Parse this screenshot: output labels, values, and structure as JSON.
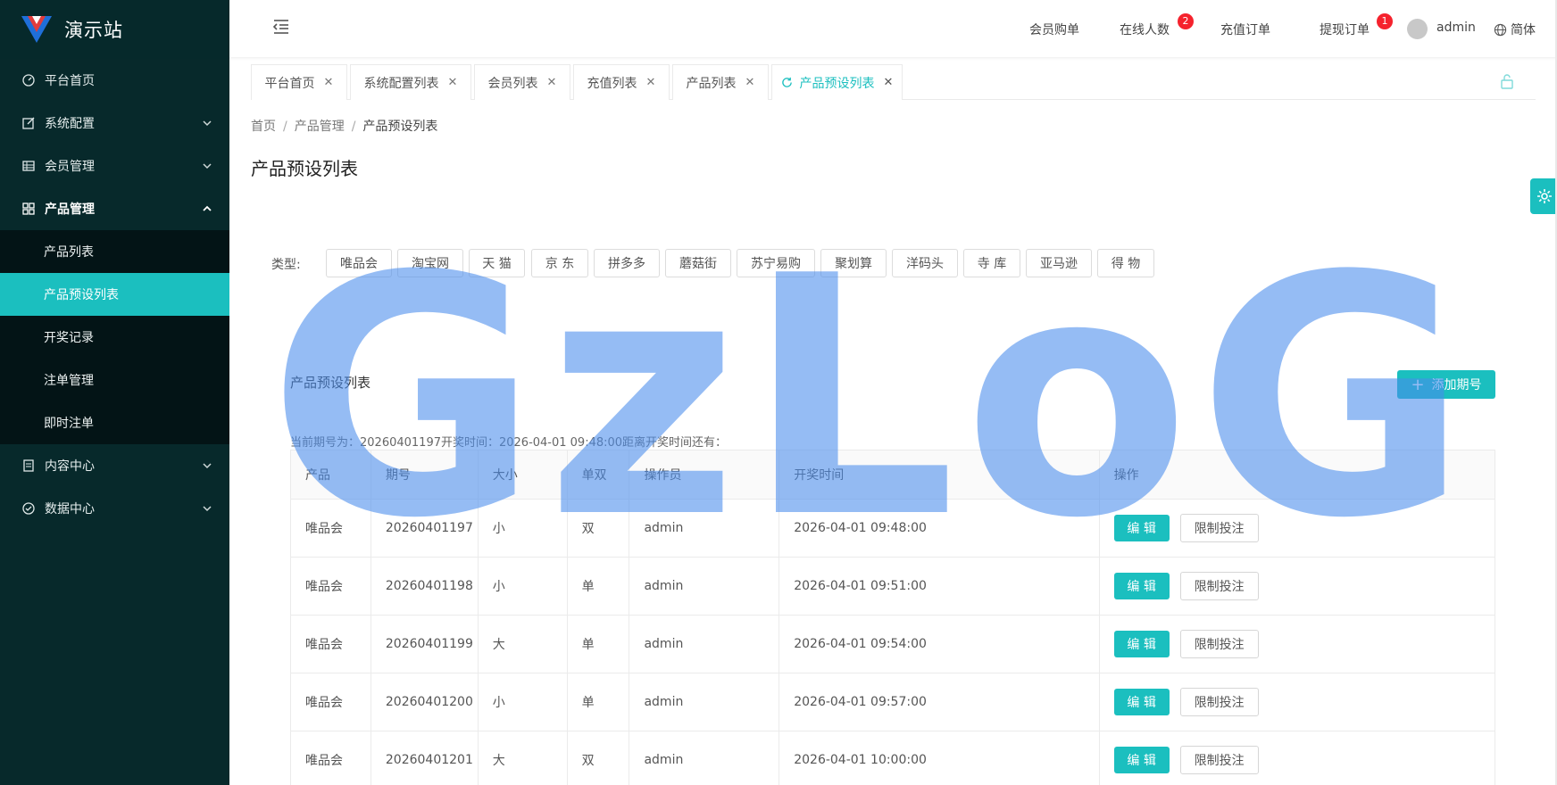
{
  "app": {
    "title": "演示站",
    "brand_color": "#1bbfbf"
  },
  "sidebar": {
    "items": [
      {
        "label": "平台首页",
        "icon": "dashboard-icon"
      },
      {
        "label": "系统配置",
        "icon": "edit-icon"
      },
      {
        "label": "会员管理",
        "icon": "table-icon"
      },
      {
        "label": "产品管理",
        "icon": "grid-icon"
      },
      {
        "label": "内容中心",
        "icon": "document-icon"
      },
      {
        "label": "数据中心",
        "icon": "check-circle-icon"
      }
    ],
    "sub_items": [
      "产品列表",
      "产品预设列表",
      "开奖记录",
      "注单管理",
      "即时注单"
    ],
    "active_sub": "产品预设列表"
  },
  "header": {
    "member_orders": "会员购单",
    "online_users": "在线人数",
    "online_badge": "2",
    "recharge_orders": "充值订单",
    "withdraw_orders": "提现订单",
    "withdraw_badge": "1",
    "username": "admin",
    "language": "简体"
  },
  "tabs": [
    {
      "label": "平台首页"
    },
    {
      "label": "系统配置列表"
    },
    {
      "label": "会员列表"
    },
    {
      "label": "充值列表"
    },
    {
      "label": "产品列表"
    },
    {
      "label": "产品预设列表"
    }
  ],
  "breadcrumb": {
    "home": "首页",
    "section": "产品管理",
    "current": "产品预设列表"
  },
  "page_title": "产品预设列表",
  "filter": {
    "label": "类型:",
    "types": [
      "唯品会",
      "淘宝网",
      "天 猫",
      "京 东",
      "拼多多",
      "蘑菇街",
      "苏宁易购",
      "聚划算",
      "洋码头",
      "寺 库",
      "亚马逊",
      "得 物"
    ]
  },
  "watermark": "GzLoG",
  "panel": {
    "title": "产品预设列表",
    "add_button": "添加期号",
    "period_info": "当前期号为：20260401197开奖时间：2026-04-01 09:48:00距离开奖时间还有："
  },
  "table": {
    "headers": [
      "产品",
      "期号",
      "大小",
      "单双",
      "操作员",
      "开奖时间",
      "操作"
    ],
    "rows": [
      [
        "唯品会",
        "20260401197",
        "小",
        "双",
        "admin",
        "2026-04-01 09:48:00"
      ],
      [
        "唯品会",
        "20260401198",
        "小",
        "单",
        "admin",
        "2026-04-01 09:51:00"
      ],
      [
        "唯品会",
        "20260401199",
        "大",
        "单",
        "admin",
        "2026-04-01 09:54:00"
      ],
      [
        "唯品会",
        "20260401200",
        "小",
        "单",
        "admin",
        "2026-04-01 09:57:00"
      ],
      [
        "唯品会",
        "20260401201",
        "大",
        "双",
        "admin",
        "2026-04-01 10:00:00"
      ]
    ],
    "edit_label": "编 辑",
    "limit_label": "限制投注"
  }
}
